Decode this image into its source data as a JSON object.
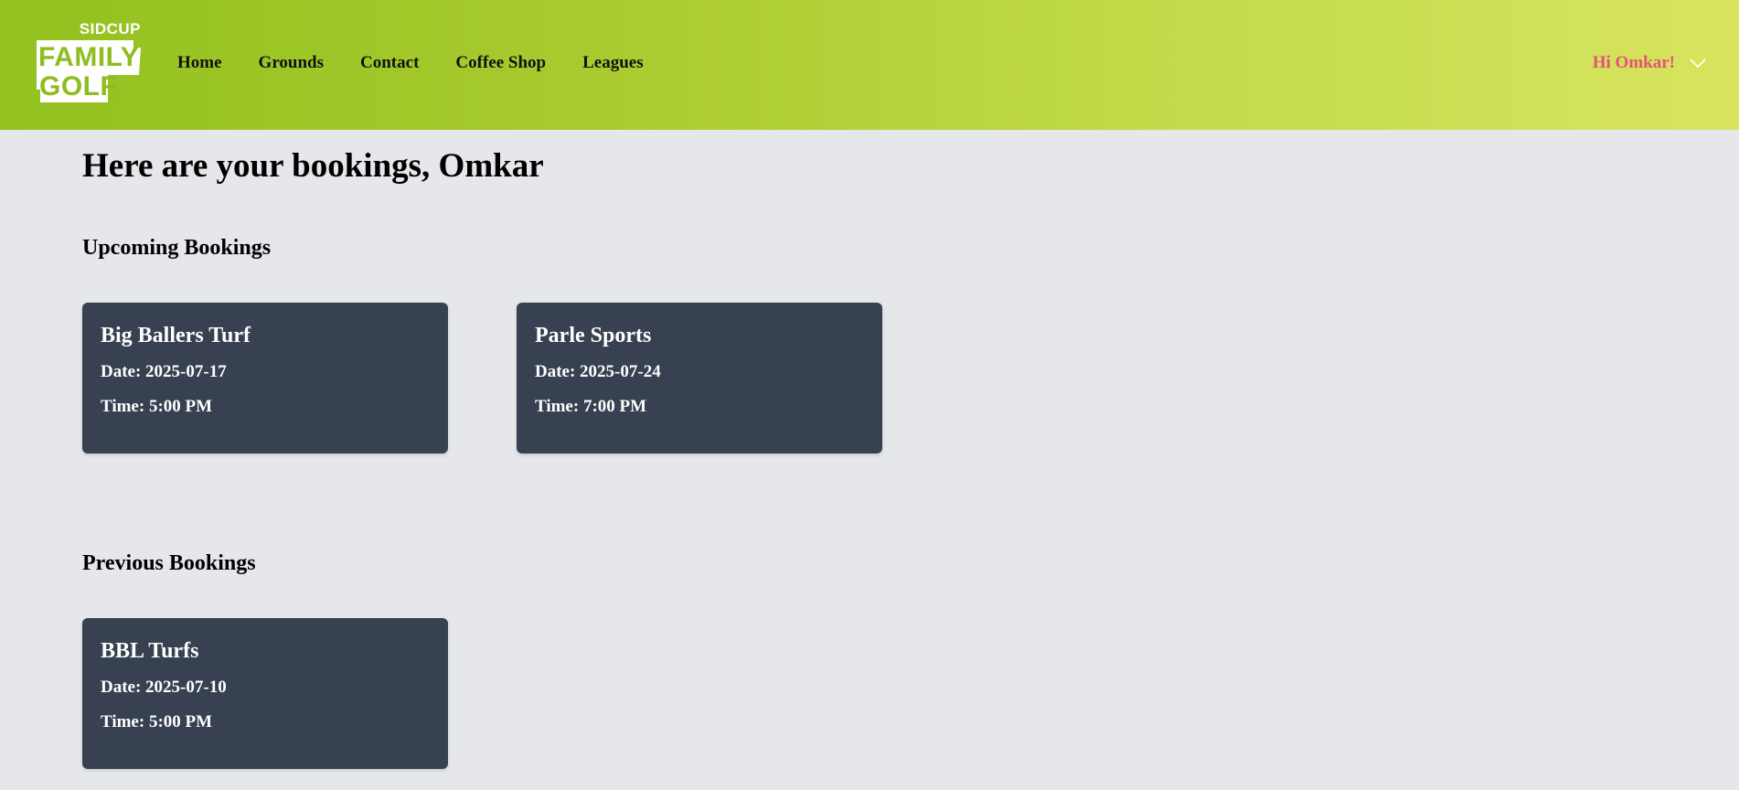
{
  "brand": {
    "top": "SIDCUP",
    "line1": "FAMILY",
    "line2": "GOLF"
  },
  "nav": [
    {
      "label": "Home"
    },
    {
      "label": "Grounds"
    },
    {
      "label": "Contact"
    },
    {
      "label": "Coffee Shop"
    },
    {
      "label": "Leagues"
    }
  ],
  "user": {
    "greeting": "Hi Omkar!",
    "menu_icon": "chevron-down-icon"
  },
  "page": {
    "title": "Here are your bookings, Omkar"
  },
  "upcoming": {
    "heading": "Upcoming Bookings",
    "bookings": [
      {
        "name": "Big Ballers Turf",
        "date": "Date: 2025-07-17",
        "time": "Time: 5:00 PM"
      },
      {
        "name": "Parle Sports",
        "date": "Date: 2025-07-24",
        "time": "Time: 7:00 PM"
      }
    ]
  },
  "previous": {
    "heading": "Previous Bookings",
    "bookings": [
      {
        "name": "BBL Turfs",
        "date": "Date: 2025-07-10",
        "time": "Time: 5:00 PM"
      }
    ]
  },
  "colors": {
    "header_start": "#93c11f",
    "header_end": "#d8e45f",
    "greeting": "#e5527a",
    "card_bg": "#374151",
    "page_bg": "#e5e7eb"
  }
}
